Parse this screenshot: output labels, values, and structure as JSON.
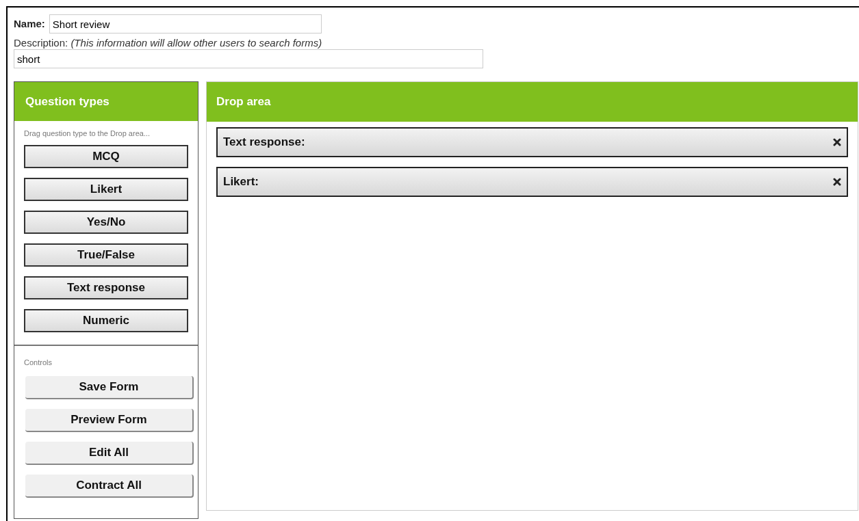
{
  "name_field": {
    "label": "Name:",
    "value": "Short review"
  },
  "description": {
    "label": "Description:",
    "hint": "(This information will allow other users to search forms)",
    "value": "short"
  },
  "question_types": {
    "title": "Question types",
    "instruction": "Drag question type to the Drop area...",
    "items": [
      "MCQ",
      "Likert",
      "Yes/No",
      "True/False",
      "Text response",
      "Numeric"
    ]
  },
  "controls": {
    "label": "Controls",
    "buttons": [
      "Save Form",
      "Preview Form",
      "Edit All",
      "Contract All"
    ]
  },
  "drop_area": {
    "title": "Drop area",
    "items": [
      {
        "label": "Text response:"
      },
      {
        "label": "Likert:"
      }
    ]
  }
}
